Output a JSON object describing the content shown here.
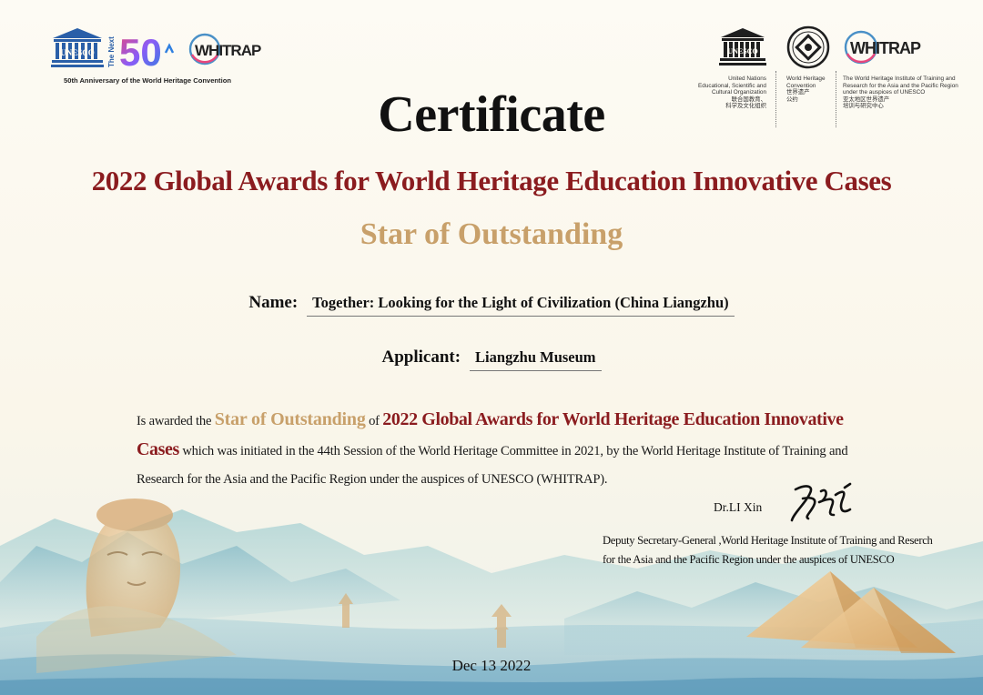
{
  "header_left": {
    "unesco_logo_text": "UNESCO",
    "next50_small": "The Next",
    "next50_big": "50",
    "whitrap_logo_text": "WHITRAP",
    "caption": "50th Anniversary of the World Heritage Convention"
  },
  "header_right": {
    "unesco_logo_text": "UNESCO",
    "whitrap_logo_text": "WHITRAP",
    "unesco_caption": [
      "United Nations",
      "Educational, Scientific and",
      "Cultural Organization",
      "联合国教育、",
      "科学及文化组织"
    ],
    "whc_caption": [
      "World Heritage",
      "Convention",
      "世界遗产",
      "公约"
    ],
    "whitrap_caption": [
      "The World Heritage Institute of Training and",
      "Research for the Asia and the Pacific Region",
      "under the auspices of UNESCO",
      "亚太地区世界遗产",
      "培训与研究中心"
    ]
  },
  "certificate": {
    "title": "Certificate",
    "award_title": "2022 Global Awards for World Heritage Education Innovative Cases",
    "award_level": "Star of Outstanding",
    "name_label": "Name:",
    "name_value": "Together: Looking for the Light of Civilization (China Liangzhu)",
    "applicant_label": "Applicant:",
    "applicant_value": "Liangzhu Museum"
  },
  "body": {
    "p1": "Is awarded the ",
    "p2": "Star of Outstanding",
    "p3": " of ",
    "p4": "2022 Global Awards for World Heritage Education Innovative Cases",
    "p5": " which was initiated in the 44th Session of the World Heritage Committee in 2021, by the World Heritage Institute of Training and Research for the Asia and the Pacific Region under the auspices of UNESCO (WHITRAP)."
  },
  "signature": {
    "name": "Dr.LI Xin",
    "title_line1": "Deputy Secretary-General ,World Heritage Institute of Training and Reserch",
    "title_line2": "for the Asia and the Pacific Region under the auspices of UNESCO"
  },
  "date": "Dec 13 2022",
  "colors": {
    "award_red": "#8b1c1f",
    "award_gold": "#c8a06a",
    "background": "#fbf8ef",
    "next50_gradient": [
      "#e8477c",
      "#8b5cf6",
      "#2f7fe0"
    ]
  }
}
